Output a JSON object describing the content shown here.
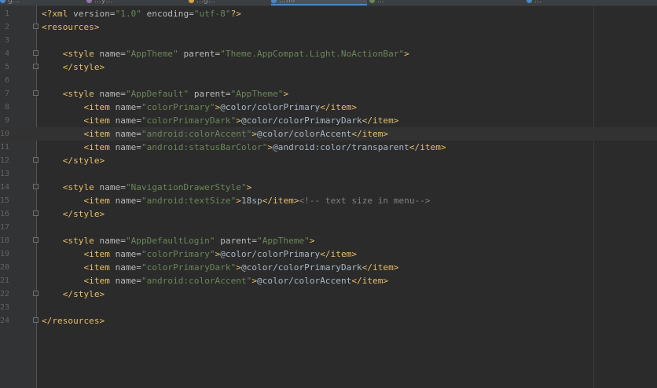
{
  "tabs": [
    {
      "label": "g…",
      "active": false
    },
    {
      "label": "…y…",
      "active": false
    },
    {
      "label": "…g…",
      "active": false
    },
    {
      "label": "…ml",
      "active": true
    },
    {
      "label": "…",
      "active": false
    },
    {
      "label": "…",
      "active": false
    }
  ],
  "colors": {
    "background": "#2b2b2b",
    "gutter": "#313335",
    "tag": "#e8bf6a",
    "attribute": "#bababa",
    "value": "#6a8759",
    "text": "#a9b7c6",
    "comment": "#808080",
    "current_line": "#323232"
  },
  "editor": {
    "current_line": 10,
    "lines": [
      {
        "n": "1",
        "fold": false,
        "tokens": [
          [
            "pi",
            "<?xml "
          ],
          [
            "attr",
            "version="
          ],
          [
            "val",
            "\"1.0\""
          ],
          [
            "attr",
            " encoding="
          ],
          [
            "val",
            "\"utf-8\""
          ],
          [
            "pi",
            "?>"
          ]
        ]
      },
      {
        "n": "2",
        "fold": true,
        "tokens": [
          [
            "tag",
            "<resources>"
          ]
        ]
      },
      {
        "n": "3",
        "fold": false,
        "tokens": []
      },
      {
        "n": "4",
        "fold": true,
        "tokens": [
          [
            "text",
            "    "
          ],
          [
            "tag",
            "<style "
          ],
          [
            "attr",
            "name="
          ],
          [
            "val",
            "\"AppTheme\""
          ],
          [
            "attr",
            " parent="
          ],
          [
            "val",
            "\"Theme.AppCompat.Light.NoActionBar\""
          ],
          [
            "tag",
            ">"
          ]
        ]
      },
      {
        "n": "5",
        "fold": true,
        "tokens": [
          [
            "text",
            "    "
          ],
          [
            "tag",
            "</style>"
          ]
        ]
      },
      {
        "n": "6",
        "fold": false,
        "tokens": []
      },
      {
        "n": "7",
        "fold": true,
        "tokens": [
          [
            "text",
            "    "
          ],
          [
            "tag",
            "<style "
          ],
          [
            "attr",
            "name="
          ],
          [
            "val",
            "\"AppDefault\""
          ],
          [
            "attr",
            " parent="
          ],
          [
            "val",
            "\"AppTheme\""
          ],
          [
            "tag",
            ">"
          ]
        ]
      },
      {
        "n": "8",
        "fold": false,
        "tokens": [
          [
            "text",
            "        "
          ],
          [
            "tag",
            "<item "
          ],
          [
            "attr",
            "name="
          ],
          [
            "val",
            "\"colorPrimary\""
          ],
          [
            "tag",
            ">"
          ],
          [
            "text",
            "@color/colorPrimary"
          ],
          [
            "tag",
            "</item>"
          ]
        ]
      },
      {
        "n": "9",
        "fold": false,
        "tokens": [
          [
            "text",
            "        "
          ],
          [
            "tag",
            "<item "
          ],
          [
            "attr",
            "name="
          ],
          [
            "val",
            "\"colorPrimaryDark\""
          ],
          [
            "tag",
            ">"
          ],
          [
            "text",
            "@color/colorPrimaryDark"
          ],
          [
            "tag",
            "</item>"
          ]
        ]
      },
      {
        "n": "10",
        "fold": false,
        "tokens": [
          [
            "text",
            "        "
          ],
          [
            "tag",
            "<item "
          ],
          [
            "attr",
            "name="
          ],
          [
            "val",
            "\"android:colorAccent\""
          ],
          [
            "tag",
            ">"
          ],
          [
            "text",
            "@color/colorAccent"
          ],
          [
            "tag",
            "</item>"
          ]
        ]
      },
      {
        "n": "11",
        "fold": false,
        "tokens": [
          [
            "text",
            "        "
          ],
          [
            "tag",
            "<item "
          ],
          [
            "attr",
            "name="
          ],
          [
            "val",
            "\"android:statusBarColor\""
          ],
          [
            "tag",
            ">"
          ],
          [
            "text",
            "@android:color/transparent"
          ],
          [
            "tag",
            "</item>"
          ]
        ]
      },
      {
        "n": "12",
        "fold": true,
        "tokens": [
          [
            "text",
            "    "
          ],
          [
            "tag",
            "</style>"
          ]
        ]
      },
      {
        "n": "13",
        "fold": false,
        "tokens": []
      },
      {
        "n": "14",
        "fold": true,
        "tokens": [
          [
            "text",
            "    "
          ],
          [
            "tag",
            "<style "
          ],
          [
            "attr",
            "name="
          ],
          [
            "val",
            "\"NavigationDrawerStyle\""
          ],
          [
            "tag",
            ">"
          ]
        ]
      },
      {
        "n": "15",
        "fold": false,
        "tokens": [
          [
            "text",
            "        "
          ],
          [
            "tag",
            "<item "
          ],
          [
            "attr",
            "name="
          ],
          [
            "val",
            "\"android:textSize\""
          ],
          [
            "tag",
            ">"
          ],
          [
            "text",
            "18sp"
          ],
          [
            "tag",
            "</item>"
          ],
          [
            "cmt",
            "<!-- text size in menu-->"
          ]
        ]
      },
      {
        "n": "16",
        "fold": true,
        "tokens": [
          [
            "text",
            "    "
          ],
          [
            "tag",
            "</style>"
          ]
        ]
      },
      {
        "n": "17",
        "fold": false,
        "tokens": []
      },
      {
        "n": "18",
        "fold": true,
        "tokens": [
          [
            "text",
            "    "
          ],
          [
            "tag",
            "<style "
          ],
          [
            "attr",
            "name="
          ],
          [
            "val",
            "\"AppDefaultLogin\""
          ],
          [
            "attr",
            " parent="
          ],
          [
            "val",
            "\"AppTheme\""
          ],
          [
            "tag",
            ">"
          ]
        ]
      },
      {
        "n": "19",
        "fold": false,
        "tokens": [
          [
            "text",
            "        "
          ],
          [
            "tag",
            "<item "
          ],
          [
            "attr",
            "name="
          ],
          [
            "val",
            "\"colorPrimary\""
          ],
          [
            "tag",
            ">"
          ],
          [
            "text",
            "@color/colorPrimary"
          ],
          [
            "tag",
            "</item>"
          ]
        ]
      },
      {
        "n": "20",
        "fold": false,
        "tokens": [
          [
            "text",
            "        "
          ],
          [
            "tag",
            "<item "
          ],
          [
            "attr",
            "name="
          ],
          [
            "val",
            "\"colorPrimaryDark\""
          ],
          [
            "tag",
            ">"
          ],
          [
            "text",
            "@color/colorPrimaryDark"
          ],
          [
            "tag",
            "</item>"
          ]
        ]
      },
      {
        "n": "21",
        "fold": false,
        "tokens": [
          [
            "text",
            "        "
          ],
          [
            "tag",
            "<item "
          ],
          [
            "attr",
            "name="
          ],
          [
            "val",
            "\"android:colorAccent\""
          ],
          [
            "tag",
            ">"
          ],
          [
            "text",
            "@color/colorAccent"
          ],
          [
            "tag",
            "</item>"
          ]
        ]
      },
      {
        "n": "22",
        "fold": true,
        "tokens": [
          [
            "text",
            "    "
          ],
          [
            "tag",
            "</style>"
          ]
        ]
      },
      {
        "n": "23",
        "fold": false,
        "tokens": []
      },
      {
        "n": "24",
        "fold": true,
        "tokens": [
          [
            "tag",
            "</resources>"
          ]
        ]
      }
    ]
  }
}
